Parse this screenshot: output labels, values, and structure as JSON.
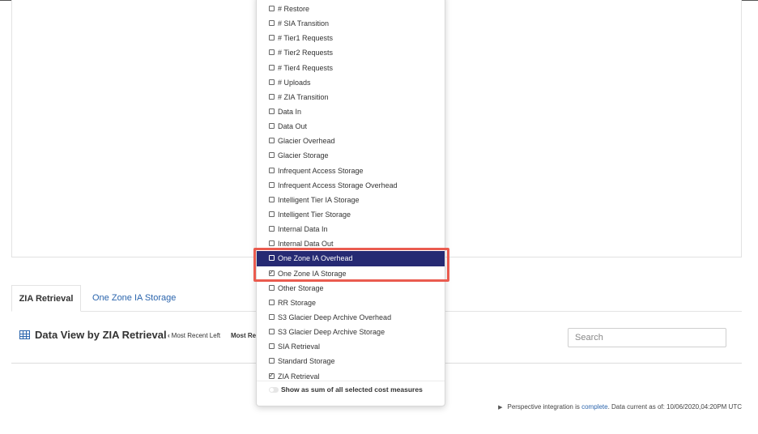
{
  "tabs": [
    {
      "label": "ZIA Retrieval",
      "active": true
    },
    {
      "label": "One Zone IA Storage",
      "active": false
    }
  ],
  "data_view": {
    "title": "Data View by ZIA Retrieval",
    "recent_left": "Most Recent Left",
    "recent_right": "Most Rec"
  },
  "search": {
    "placeholder": "Search",
    "value": ""
  },
  "footer": {
    "prefix": "Perspective integration is",
    "link": "complete",
    "suffix": ". Data current as of: 10/06/2020,04:20PM UTC"
  },
  "dropdown": {
    "items": [
      {
        "label": "# Restore",
        "checked": false,
        "highlighted": false
      },
      {
        "label": "# SIA Transition",
        "checked": false,
        "highlighted": false
      },
      {
        "label": "# Tier1 Requests",
        "checked": false,
        "highlighted": false
      },
      {
        "label": "# Tier2 Requests",
        "checked": false,
        "highlighted": false
      },
      {
        "label": "# Tier4 Requests",
        "checked": false,
        "highlighted": false
      },
      {
        "label": "# Uploads",
        "checked": false,
        "highlighted": false
      },
      {
        "label": "# ZIA Transition",
        "checked": false,
        "highlighted": false
      },
      {
        "label": "Data In",
        "checked": false,
        "highlighted": false
      },
      {
        "label": "Data Out",
        "checked": false,
        "highlighted": false
      },
      {
        "label": "Glacier Overhead",
        "checked": false,
        "highlighted": false
      },
      {
        "label": "Glacier Storage",
        "checked": false,
        "highlighted": false
      },
      {
        "label": "Infrequent Access Storage",
        "checked": false,
        "highlighted": false
      },
      {
        "label": "Infrequent Access Storage Overhead",
        "checked": false,
        "highlighted": false
      },
      {
        "label": "Intelligent Tier IA Storage",
        "checked": false,
        "highlighted": false
      },
      {
        "label": "Intelligent Tier Storage",
        "checked": false,
        "highlighted": false
      },
      {
        "label": "Internal Data In",
        "checked": false,
        "highlighted": false
      },
      {
        "label": "Internal Data Out",
        "checked": false,
        "highlighted": false
      },
      {
        "label": "One Zone IA Overhead",
        "checked": false,
        "highlighted": true
      },
      {
        "label": "One Zone IA Storage",
        "checked": true,
        "highlighted": false
      },
      {
        "label": "Other Storage",
        "checked": false,
        "highlighted": false
      },
      {
        "label": "RR Storage",
        "checked": false,
        "highlighted": false
      },
      {
        "label": "S3 Glacier Deep Archive Overhead",
        "checked": false,
        "highlighted": false
      },
      {
        "label": "S3 Glacier Deep Archive Storage",
        "checked": false,
        "highlighted": false
      },
      {
        "label": "SIA Retrieval",
        "checked": false,
        "highlighted": false
      },
      {
        "label": "Standard Storage",
        "checked": false,
        "highlighted": false
      },
      {
        "label": "ZIA Retrieval",
        "checked": true,
        "highlighted": false
      }
    ],
    "sum_toggle_label": "Show as sum of all selected cost measures",
    "sum_toggle_on": false
  },
  "colors": {
    "highlight_bg": "#262a73",
    "link": "#2b65ad",
    "annotation_border": "#ea5b4f"
  }
}
